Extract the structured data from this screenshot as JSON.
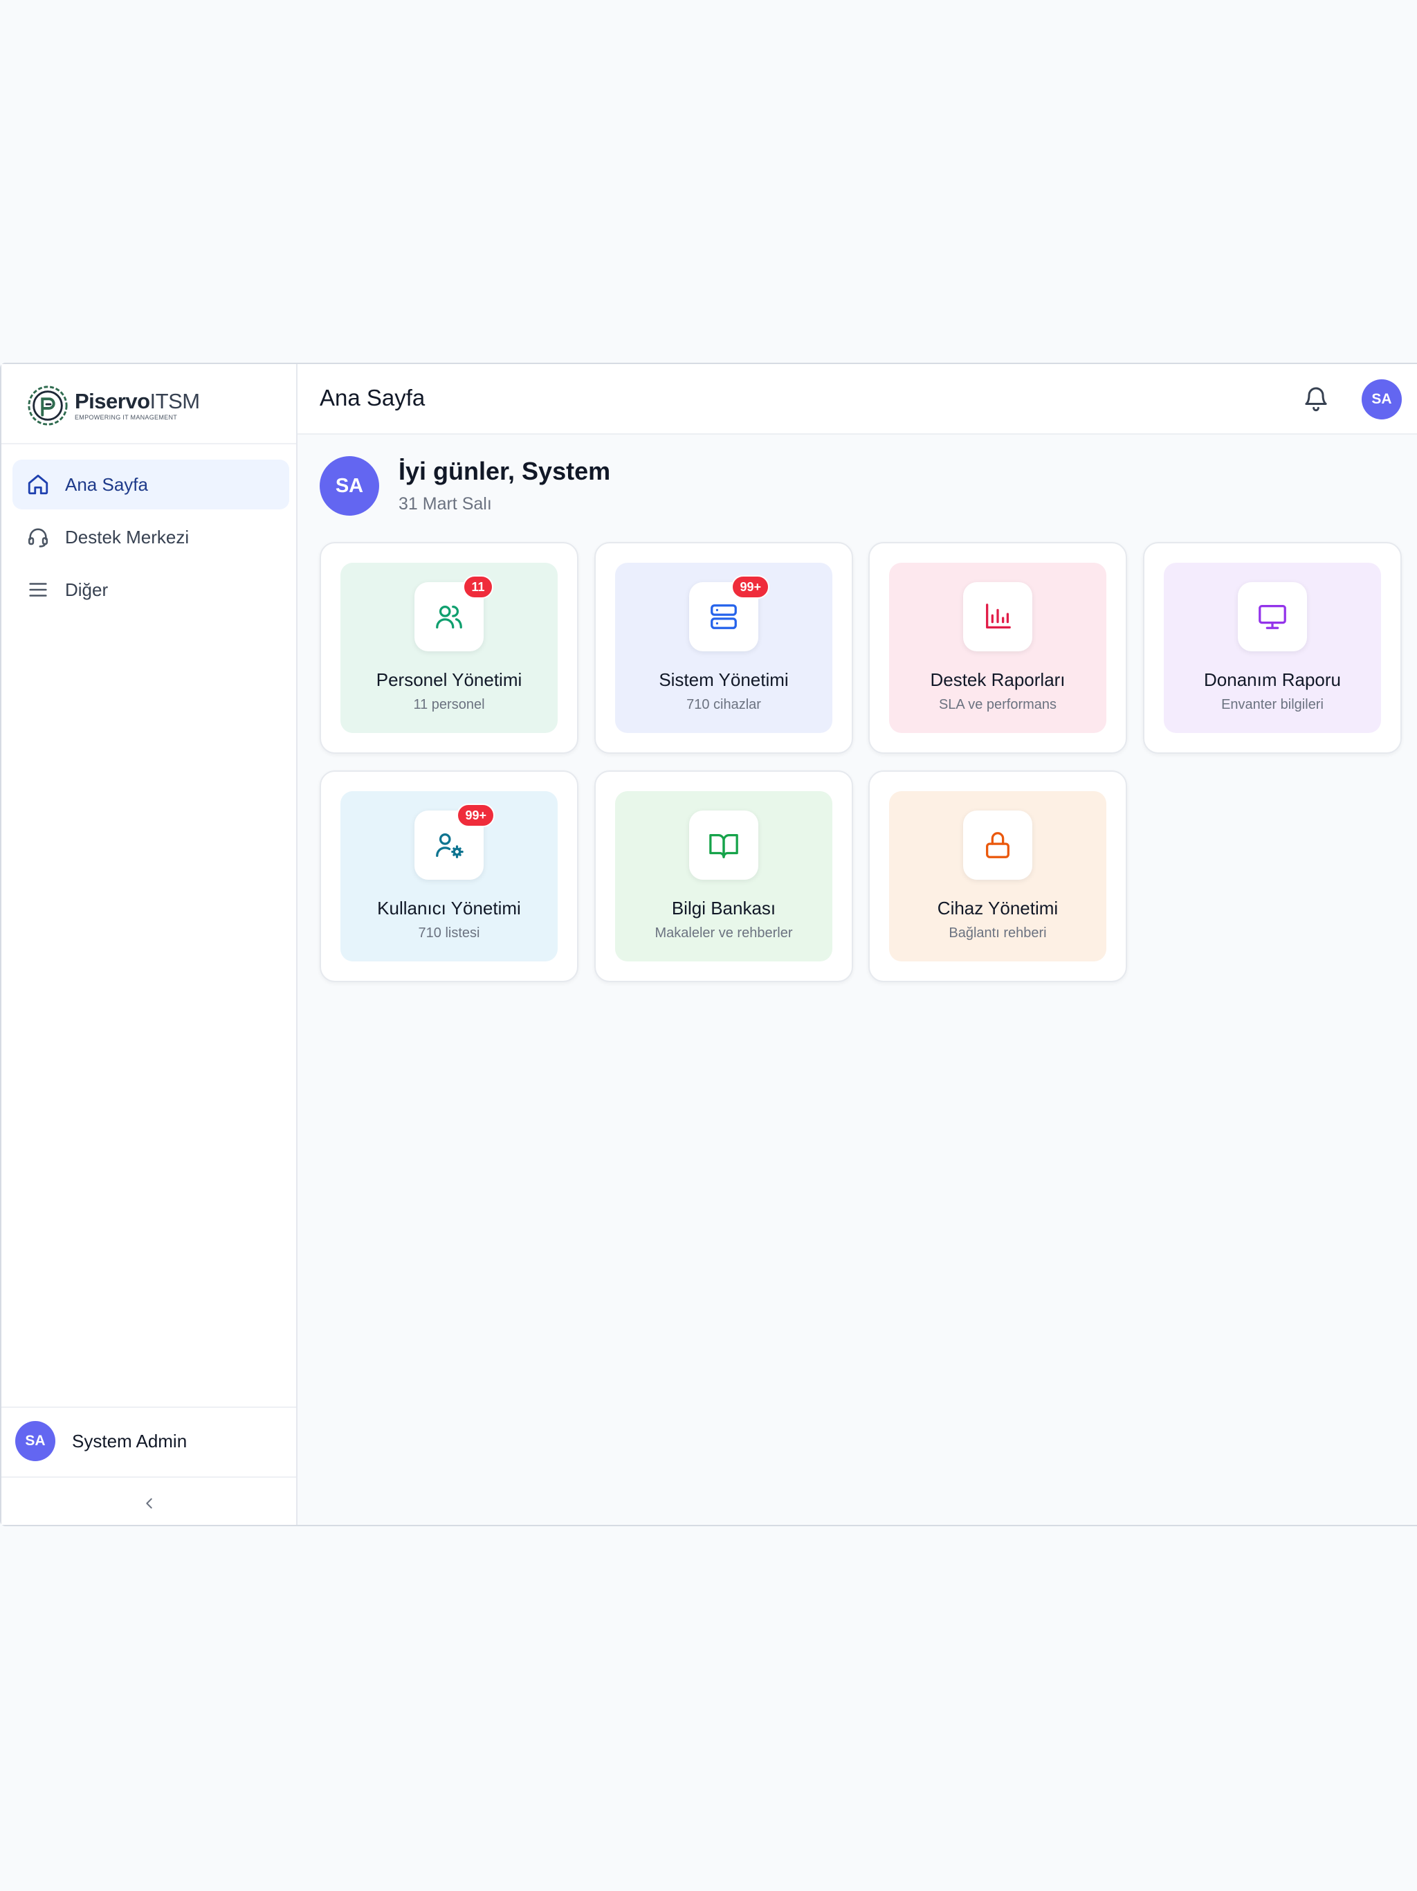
{
  "brand": {
    "name": "Piservo",
    "suffix": "ITSM",
    "tagline": "EMPOWERING IT MANAGEMENT"
  },
  "sidebar": {
    "items": [
      {
        "label": "Ana Sayfa",
        "icon": "home-icon",
        "active": true
      },
      {
        "label": "Destek Merkezi",
        "icon": "headset-icon",
        "active": false
      },
      {
        "label": "Diğer",
        "icon": "menu-icon",
        "active": false
      }
    ],
    "user": {
      "initials": "SA",
      "name": "System Admin"
    },
    "collapse_icon": "chevron-left-icon"
  },
  "header": {
    "title": "Ana Sayfa",
    "avatar_initials": "SA",
    "notification_icon": "bell-icon"
  },
  "greeting": {
    "initials": "SA",
    "title": "İyi günler, System",
    "date": "31 Mart Salı"
  },
  "cards": [
    {
      "title": "Personel Yönetimi",
      "subtitle": "11 personel",
      "badge": "11",
      "icon": "users-icon",
      "bg": "#e7f6ef",
      "color": "#0f9f6e"
    },
    {
      "title": "Sistem Yönetimi",
      "subtitle": "710 cihazlar",
      "badge": "99+",
      "icon": "server-icon",
      "bg": "#ebeffd",
      "color": "#2563eb"
    },
    {
      "title": "Destek Raporları",
      "subtitle": "SLA ve performans",
      "badge": "",
      "icon": "bar-chart-icon",
      "bg": "#fde8ee",
      "color": "#e11d48"
    },
    {
      "title": "Donanım Raporu",
      "subtitle": "Envanter bilgileri",
      "badge": "",
      "icon": "monitor-icon",
      "bg": "#f4ecfd",
      "color": "#9333ea"
    },
    {
      "title": "Kullanıcı Yönetimi",
      "subtitle": "710 listesi",
      "badge": "99+",
      "icon": "user-cog-icon",
      "bg": "#e6f4fb",
      "color": "#0e7490"
    },
    {
      "title": "Bilgi Bankası",
      "subtitle": "Makaleler ve rehberler",
      "badge": "",
      "icon": "book-open-icon",
      "bg": "#e8f7ea",
      "color": "#16a34a"
    },
    {
      "title": "Cihaz Yönetimi",
      "subtitle": "Bağlantı rehberi",
      "badge": "",
      "icon": "lock-icon",
      "bg": "#fdf0e4",
      "color": "#ea580c"
    }
  ]
}
